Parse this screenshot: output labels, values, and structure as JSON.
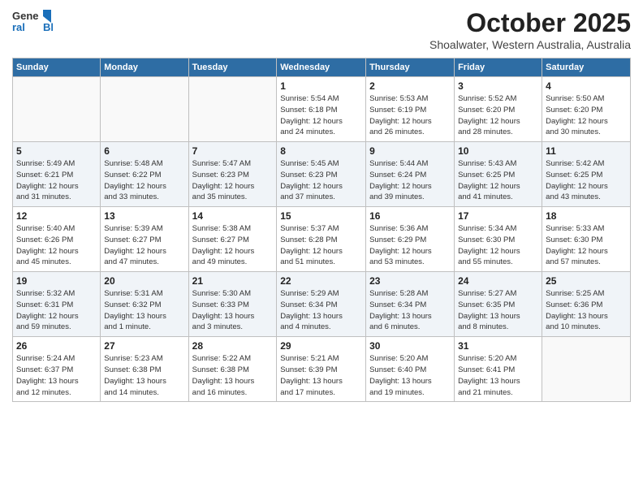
{
  "header": {
    "logo_line1": "General",
    "logo_line2": "Blue",
    "month_year": "October 2025",
    "location": "Shoalwater, Western Australia, Australia"
  },
  "weekdays": [
    "Sunday",
    "Monday",
    "Tuesday",
    "Wednesday",
    "Thursday",
    "Friday",
    "Saturday"
  ],
  "weeks": [
    [
      {
        "day": "",
        "info": ""
      },
      {
        "day": "",
        "info": ""
      },
      {
        "day": "",
        "info": ""
      },
      {
        "day": "1",
        "info": "Sunrise: 5:54 AM\nSunset: 6:18 PM\nDaylight: 12 hours\nand 24 minutes."
      },
      {
        "day": "2",
        "info": "Sunrise: 5:53 AM\nSunset: 6:19 PM\nDaylight: 12 hours\nand 26 minutes."
      },
      {
        "day": "3",
        "info": "Sunrise: 5:52 AM\nSunset: 6:20 PM\nDaylight: 12 hours\nand 28 minutes."
      },
      {
        "day": "4",
        "info": "Sunrise: 5:50 AM\nSunset: 6:20 PM\nDaylight: 12 hours\nand 30 minutes."
      }
    ],
    [
      {
        "day": "5",
        "info": "Sunrise: 5:49 AM\nSunset: 6:21 PM\nDaylight: 12 hours\nand 31 minutes."
      },
      {
        "day": "6",
        "info": "Sunrise: 5:48 AM\nSunset: 6:22 PM\nDaylight: 12 hours\nand 33 minutes."
      },
      {
        "day": "7",
        "info": "Sunrise: 5:47 AM\nSunset: 6:23 PM\nDaylight: 12 hours\nand 35 minutes."
      },
      {
        "day": "8",
        "info": "Sunrise: 5:45 AM\nSunset: 6:23 PM\nDaylight: 12 hours\nand 37 minutes."
      },
      {
        "day": "9",
        "info": "Sunrise: 5:44 AM\nSunset: 6:24 PM\nDaylight: 12 hours\nand 39 minutes."
      },
      {
        "day": "10",
        "info": "Sunrise: 5:43 AM\nSunset: 6:25 PM\nDaylight: 12 hours\nand 41 minutes."
      },
      {
        "day": "11",
        "info": "Sunrise: 5:42 AM\nSunset: 6:25 PM\nDaylight: 12 hours\nand 43 minutes."
      }
    ],
    [
      {
        "day": "12",
        "info": "Sunrise: 5:40 AM\nSunset: 6:26 PM\nDaylight: 12 hours\nand 45 minutes."
      },
      {
        "day": "13",
        "info": "Sunrise: 5:39 AM\nSunset: 6:27 PM\nDaylight: 12 hours\nand 47 minutes."
      },
      {
        "day": "14",
        "info": "Sunrise: 5:38 AM\nSunset: 6:27 PM\nDaylight: 12 hours\nand 49 minutes."
      },
      {
        "day": "15",
        "info": "Sunrise: 5:37 AM\nSunset: 6:28 PM\nDaylight: 12 hours\nand 51 minutes."
      },
      {
        "day": "16",
        "info": "Sunrise: 5:36 AM\nSunset: 6:29 PM\nDaylight: 12 hours\nand 53 minutes."
      },
      {
        "day": "17",
        "info": "Sunrise: 5:34 AM\nSunset: 6:30 PM\nDaylight: 12 hours\nand 55 minutes."
      },
      {
        "day": "18",
        "info": "Sunrise: 5:33 AM\nSunset: 6:30 PM\nDaylight: 12 hours\nand 57 minutes."
      }
    ],
    [
      {
        "day": "19",
        "info": "Sunrise: 5:32 AM\nSunset: 6:31 PM\nDaylight: 12 hours\nand 59 minutes."
      },
      {
        "day": "20",
        "info": "Sunrise: 5:31 AM\nSunset: 6:32 PM\nDaylight: 13 hours\nand 1 minute."
      },
      {
        "day": "21",
        "info": "Sunrise: 5:30 AM\nSunset: 6:33 PM\nDaylight: 13 hours\nand 3 minutes."
      },
      {
        "day": "22",
        "info": "Sunrise: 5:29 AM\nSunset: 6:34 PM\nDaylight: 13 hours\nand 4 minutes."
      },
      {
        "day": "23",
        "info": "Sunrise: 5:28 AM\nSunset: 6:34 PM\nDaylight: 13 hours\nand 6 minutes."
      },
      {
        "day": "24",
        "info": "Sunrise: 5:27 AM\nSunset: 6:35 PM\nDaylight: 13 hours\nand 8 minutes."
      },
      {
        "day": "25",
        "info": "Sunrise: 5:25 AM\nSunset: 6:36 PM\nDaylight: 13 hours\nand 10 minutes."
      }
    ],
    [
      {
        "day": "26",
        "info": "Sunrise: 5:24 AM\nSunset: 6:37 PM\nDaylight: 13 hours\nand 12 minutes."
      },
      {
        "day": "27",
        "info": "Sunrise: 5:23 AM\nSunset: 6:38 PM\nDaylight: 13 hours\nand 14 minutes."
      },
      {
        "day": "28",
        "info": "Sunrise: 5:22 AM\nSunset: 6:38 PM\nDaylight: 13 hours\nand 16 minutes."
      },
      {
        "day": "29",
        "info": "Sunrise: 5:21 AM\nSunset: 6:39 PM\nDaylight: 13 hours\nand 17 minutes."
      },
      {
        "day": "30",
        "info": "Sunrise: 5:20 AM\nSunset: 6:40 PM\nDaylight: 13 hours\nand 19 minutes."
      },
      {
        "day": "31",
        "info": "Sunrise: 5:20 AM\nSunset: 6:41 PM\nDaylight: 13 hours\nand 21 minutes."
      },
      {
        "day": "",
        "info": ""
      }
    ]
  ]
}
